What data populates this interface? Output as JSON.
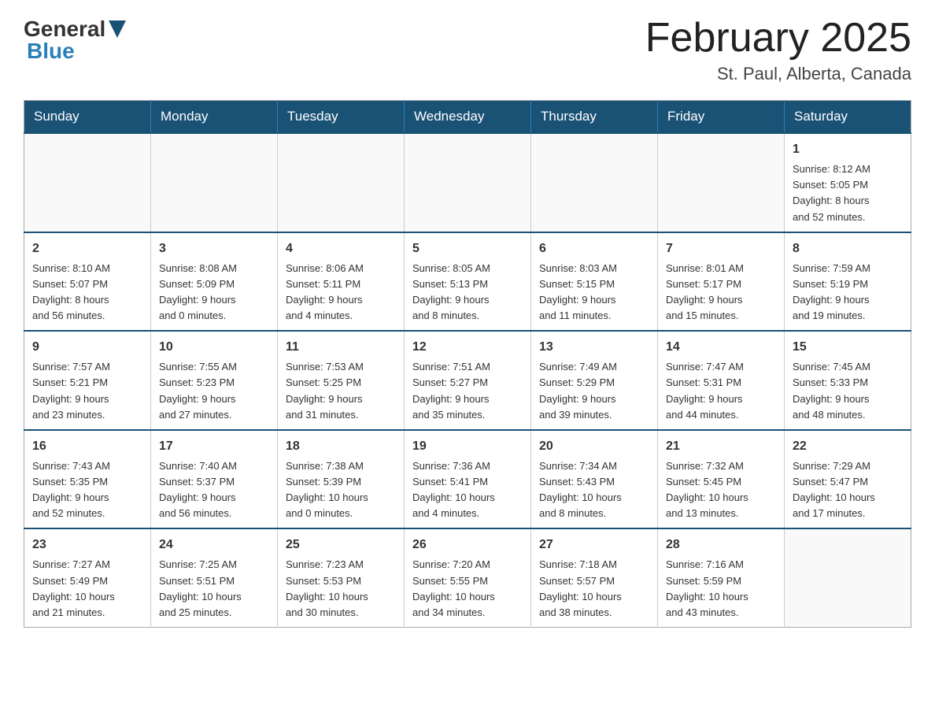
{
  "logo": {
    "general": "General",
    "blue": "Blue"
  },
  "title": {
    "month": "February 2025",
    "location": "St. Paul, Alberta, Canada"
  },
  "weekdays": [
    "Sunday",
    "Monday",
    "Tuesday",
    "Wednesday",
    "Thursday",
    "Friday",
    "Saturday"
  ],
  "weeks": [
    [
      {
        "day": "",
        "info": ""
      },
      {
        "day": "",
        "info": ""
      },
      {
        "day": "",
        "info": ""
      },
      {
        "day": "",
        "info": ""
      },
      {
        "day": "",
        "info": ""
      },
      {
        "day": "",
        "info": ""
      },
      {
        "day": "1",
        "info": "Sunrise: 8:12 AM\nSunset: 5:05 PM\nDaylight: 8 hours\nand 52 minutes."
      }
    ],
    [
      {
        "day": "2",
        "info": "Sunrise: 8:10 AM\nSunset: 5:07 PM\nDaylight: 8 hours\nand 56 minutes."
      },
      {
        "day": "3",
        "info": "Sunrise: 8:08 AM\nSunset: 5:09 PM\nDaylight: 9 hours\nand 0 minutes."
      },
      {
        "day": "4",
        "info": "Sunrise: 8:06 AM\nSunset: 5:11 PM\nDaylight: 9 hours\nand 4 minutes."
      },
      {
        "day": "5",
        "info": "Sunrise: 8:05 AM\nSunset: 5:13 PM\nDaylight: 9 hours\nand 8 minutes."
      },
      {
        "day": "6",
        "info": "Sunrise: 8:03 AM\nSunset: 5:15 PM\nDaylight: 9 hours\nand 11 minutes."
      },
      {
        "day": "7",
        "info": "Sunrise: 8:01 AM\nSunset: 5:17 PM\nDaylight: 9 hours\nand 15 minutes."
      },
      {
        "day": "8",
        "info": "Sunrise: 7:59 AM\nSunset: 5:19 PM\nDaylight: 9 hours\nand 19 minutes."
      }
    ],
    [
      {
        "day": "9",
        "info": "Sunrise: 7:57 AM\nSunset: 5:21 PM\nDaylight: 9 hours\nand 23 minutes."
      },
      {
        "day": "10",
        "info": "Sunrise: 7:55 AM\nSunset: 5:23 PM\nDaylight: 9 hours\nand 27 minutes."
      },
      {
        "day": "11",
        "info": "Sunrise: 7:53 AM\nSunset: 5:25 PM\nDaylight: 9 hours\nand 31 minutes."
      },
      {
        "day": "12",
        "info": "Sunrise: 7:51 AM\nSunset: 5:27 PM\nDaylight: 9 hours\nand 35 minutes."
      },
      {
        "day": "13",
        "info": "Sunrise: 7:49 AM\nSunset: 5:29 PM\nDaylight: 9 hours\nand 39 minutes."
      },
      {
        "day": "14",
        "info": "Sunrise: 7:47 AM\nSunset: 5:31 PM\nDaylight: 9 hours\nand 44 minutes."
      },
      {
        "day": "15",
        "info": "Sunrise: 7:45 AM\nSunset: 5:33 PM\nDaylight: 9 hours\nand 48 minutes."
      }
    ],
    [
      {
        "day": "16",
        "info": "Sunrise: 7:43 AM\nSunset: 5:35 PM\nDaylight: 9 hours\nand 52 minutes."
      },
      {
        "day": "17",
        "info": "Sunrise: 7:40 AM\nSunset: 5:37 PM\nDaylight: 9 hours\nand 56 minutes."
      },
      {
        "day": "18",
        "info": "Sunrise: 7:38 AM\nSunset: 5:39 PM\nDaylight: 10 hours\nand 0 minutes."
      },
      {
        "day": "19",
        "info": "Sunrise: 7:36 AM\nSunset: 5:41 PM\nDaylight: 10 hours\nand 4 minutes."
      },
      {
        "day": "20",
        "info": "Sunrise: 7:34 AM\nSunset: 5:43 PM\nDaylight: 10 hours\nand 8 minutes."
      },
      {
        "day": "21",
        "info": "Sunrise: 7:32 AM\nSunset: 5:45 PM\nDaylight: 10 hours\nand 13 minutes."
      },
      {
        "day": "22",
        "info": "Sunrise: 7:29 AM\nSunset: 5:47 PM\nDaylight: 10 hours\nand 17 minutes."
      }
    ],
    [
      {
        "day": "23",
        "info": "Sunrise: 7:27 AM\nSunset: 5:49 PM\nDaylight: 10 hours\nand 21 minutes."
      },
      {
        "day": "24",
        "info": "Sunrise: 7:25 AM\nSunset: 5:51 PM\nDaylight: 10 hours\nand 25 minutes."
      },
      {
        "day": "25",
        "info": "Sunrise: 7:23 AM\nSunset: 5:53 PM\nDaylight: 10 hours\nand 30 minutes."
      },
      {
        "day": "26",
        "info": "Sunrise: 7:20 AM\nSunset: 5:55 PM\nDaylight: 10 hours\nand 34 minutes."
      },
      {
        "day": "27",
        "info": "Sunrise: 7:18 AM\nSunset: 5:57 PM\nDaylight: 10 hours\nand 38 minutes."
      },
      {
        "day": "28",
        "info": "Sunrise: 7:16 AM\nSunset: 5:59 PM\nDaylight: 10 hours\nand 43 minutes."
      },
      {
        "day": "",
        "info": ""
      }
    ]
  ]
}
